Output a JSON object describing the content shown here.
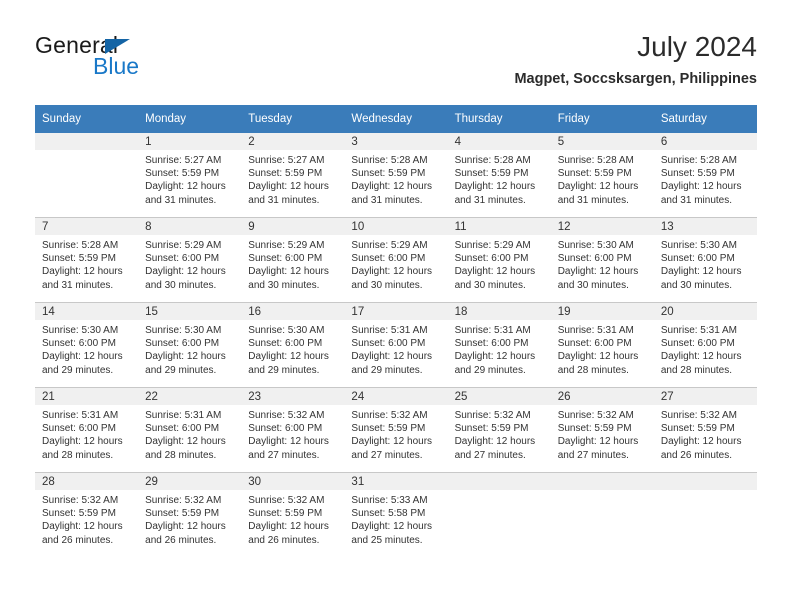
{
  "logo": {
    "text_top": "General",
    "text_bottom": "Blue",
    "triangle_color": "#1464a5",
    "blue_color": "#1978c8"
  },
  "header": {
    "title": "July 2024",
    "subtitle": "Magpet, Soccsksargen, Philippines"
  },
  "theme": {
    "header_blue": "#3a7cba",
    "daynum_band": "#f0f0f0",
    "row_divider": "#c8c8c8",
    "text": "#333333"
  },
  "calendar": {
    "weekday_headers": [
      "Sunday",
      "Monday",
      "Tuesday",
      "Wednesday",
      "Thursday",
      "Friday",
      "Saturday"
    ],
    "weeks": [
      [
        {
          "day": "",
          "sunrise": "",
          "sunset": "",
          "daylight_line1": "",
          "daylight_line2": ""
        },
        {
          "day": "1",
          "sunrise": "Sunrise: 5:27 AM",
          "sunset": "Sunset: 5:59 PM",
          "daylight_line1": "Daylight: 12 hours",
          "daylight_line2": "and 31 minutes."
        },
        {
          "day": "2",
          "sunrise": "Sunrise: 5:27 AM",
          "sunset": "Sunset: 5:59 PM",
          "daylight_line1": "Daylight: 12 hours",
          "daylight_line2": "and 31 minutes."
        },
        {
          "day": "3",
          "sunrise": "Sunrise: 5:28 AM",
          "sunset": "Sunset: 5:59 PM",
          "daylight_line1": "Daylight: 12 hours",
          "daylight_line2": "and 31 minutes."
        },
        {
          "day": "4",
          "sunrise": "Sunrise: 5:28 AM",
          "sunset": "Sunset: 5:59 PM",
          "daylight_line1": "Daylight: 12 hours",
          "daylight_line2": "and 31 minutes."
        },
        {
          "day": "5",
          "sunrise": "Sunrise: 5:28 AM",
          "sunset": "Sunset: 5:59 PM",
          "daylight_line1": "Daylight: 12 hours",
          "daylight_line2": "and 31 minutes."
        },
        {
          "day": "6",
          "sunrise": "Sunrise: 5:28 AM",
          "sunset": "Sunset: 5:59 PM",
          "daylight_line1": "Daylight: 12 hours",
          "daylight_line2": "and 31 minutes."
        }
      ],
      [
        {
          "day": "7",
          "sunrise": "Sunrise: 5:28 AM",
          "sunset": "Sunset: 5:59 PM",
          "daylight_line1": "Daylight: 12 hours",
          "daylight_line2": "and 31 minutes."
        },
        {
          "day": "8",
          "sunrise": "Sunrise: 5:29 AM",
          "sunset": "Sunset: 6:00 PM",
          "daylight_line1": "Daylight: 12 hours",
          "daylight_line2": "and 30 minutes."
        },
        {
          "day": "9",
          "sunrise": "Sunrise: 5:29 AM",
          "sunset": "Sunset: 6:00 PM",
          "daylight_line1": "Daylight: 12 hours",
          "daylight_line2": "and 30 minutes."
        },
        {
          "day": "10",
          "sunrise": "Sunrise: 5:29 AM",
          "sunset": "Sunset: 6:00 PM",
          "daylight_line1": "Daylight: 12 hours",
          "daylight_line2": "and 30 minutes."
        },
        {
          "day": "11",
          "sunrise": "Sunrise: 5:29 AM",
          "sunset": "Sunset: 6:00 PM",
          "daylight_line1": "Daylight: 12 hours",
          "daylight_line2": "and 30 minutes."
        },
        {
          "day": "12",
          "sunrise": "Sunrise: 5:30 AM",
          "sunset": "Sunset: 6:00 PM",
          "daylight_line1": "Daylight: 12 hours",
          "daylight_line2": "and 30 minutes."
        },
        {
          "day": "13",
          "sunrise": "Sunrise: 5:30 AM",
          "sunset": "Sunset: 6:00 PM",
          "daylight_line1": "Daylight: 12 hours",
          "daylight_line2": "and 30 minutes."
        }
      ],
      [
        {
          "day": "14",
          "sunrise": "Sunrise: 5:30 AM",
          "sunset": "Sunset: 6:00 PM",
          "daylight_line1": "Daylight: 12 hours",
          "daylight_line2": "and 29 minutes."
        },
        {
          "day": "15",
          "sunrise": "Sunrise: 5:30 AM",
          "sunset": "Sunset: 6:00 PM",
          "daylight_line1": "Daylight: 12 hours",
          "daylight_line2": "and 29 minutes."
        },
        {
          "day": "16",
          "sunrise": "Sunrise: 5:30 AM",
          "sunset": "Sunset: 6:00 PM",
          "daylight_line1": "Daylight: 12 hours",
          "daylight_line2": "and 29 minutes."
        },
        {
          "day": "17",
          "sunrise": "Sunrise: 5:31 AM",
          "sunset": "Sunset: 6:00 PM",
          "daylight_line1": "Daylight: 12 hours",
          "daylight_line2": "and 29 minutes."
        },
        {
          "day": "18",
          "sunrise": "Sunrise: 5:31 AM",
          "sunset": "Sunset: 6:00 PM",
          "daylight_line1": "Daylight: 12 hours",
          "daylight_line2": "and 29 minutes."
        },
        {
          "day": "19",
          "sunrise": "Sunrise: 5:31 AM",
          "sunset": "Sunset: 6:00 PM",
          "daylight_line1": "Daylight: 12 hours",
          "daylight_line2": "and 28 minutes."
        },
        {
          "day": "20",
          "sunrise": "Sunrise: 5:31 AM",
          "sunset": "Sunset: 6:00 PM",
          "daylight_line1": "Daylight: 12 hours",
          "daylight_line2": "and 28 minutes."
        }
      ],
      [
        {
          "day": "21",
          "sunrise": "Sunrise: 5:31 AM",
          "sunset": "Sunset: 6:00 PM",
          "daylight_line1": "Daylight: 12 hours",
          "daylight_line2": "and 28 minutes."
        },
        {
          "day": "22",
          "sunrise": "Sunrise: 5:31 AM",
          "sunset": "Sunset: 6:00 PM",
          "daylight_line1": "Daylight: 12 hours",
          "daylight_line2": "and 28 minutes."
        },
        {
          "day": "23",
          "sunrise": "Sunrise: 5:32 AM",
          "sunset": "Sunset: 6:00 PM",
          "daylight_line1": "Daylight: 12 hours",
          "daylight_line2": "and 27 minutes."
        },
        {
          "day": "24",
          "sunrise": "Sunrise: 5:32 AM",
          "sunset": "Sunset: 5:59 PM",
          "daylight_line1": "Daylight: 12 hours",
          "daylight_line2": "and 27 minutes."
        },
        {
          "day": "25",
          "sunrise": "Sunrise: 5:32 AM",
          "sunset": "Sunset: 5:59 PM",
          "daylight_line1": "Daylight: 12 hours",
          "daylight_line2": "and 27 minutes."
        },
        {
          "day": "26",
          "sunrise": "Sunrise: 5:32 AM",
          "sunset": "Sunset: 5:59 PM",
          "daylight_line1": "Daylight: 12 hours",
          "daylight_line2": "and 27 minutes."
        },
        {
          "day": "27",
          "sunrise": "Sunrise: 5:32 AM",
          "sunset": "Sunset: 5:59 PM",
          "daylight_line1": "Daylight: 12 hours",
          "daylight_line2": "and 26 minutes."
        }
      ],
      [
        {
          "day": "28",
          "sunrise": "Sunrise: 5:32 AM",
          "sunset": "Sunset: 5:59 PM",
          "daylight_line1": "Daylight: 12 hours",
          "daylight_line2": "and 26 minutes."
        },
        {
          "day": "29",
          "sunrise": "Sunrise: 5:32 AM",
          "sunset": "Sunset: 5:59 PM",
          "daylight_line1": "Daylight: 12 hours",
          "daylight_line2": "and 26 minutes."
        },
        {
          "day": "30",
          "sunrise": "Sunrise: 5:32 AM",
          "sunset": "Sunset: 5:59 PM",
          "daylight_line1": "Daylight: 12 hours",
          "daylight_line2": "and 26 minutes."
        },
        {
          "day": "31",
          "sunrise": "Sunrise: 5:33 AM",
          "sunset": "Sunset: 5:58 PM",
          "daylight_line1": "Daylight: 12 hours",
          "daylight_line2": "and 25 minutes."
        },
        {
          "day": "",
          "sunrise": "",
          "sunset": "",
          "daylight_line1": "",
          "daylight_line2": ""
        },
        {
          "day": "",
          "sunrise": "",
          "sunset": "",
          "daylight_line1": "",
          "daylight_line2": ""
        },
        {
          "day": "",
          "sunrise": "",
          "sunset": "",
          "daylight_line1": "",
          "daylight_line2": ""
        }
      ]
    ]
  }
}
